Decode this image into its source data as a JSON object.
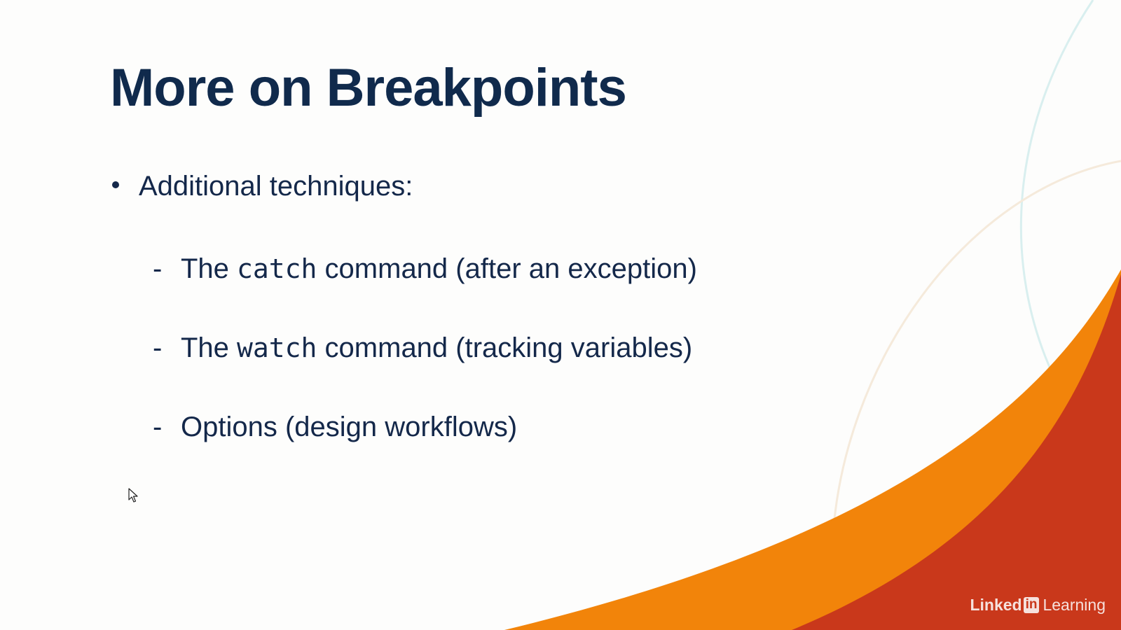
{
  "slide": {
    "title": "More on Breakpoints",
    "bullet": "Additional techniques:",
    "sub_items": [
      {
        "dash": "-",
        "prefix": "The ",
        "code": "catch",
        "suffix": " command (after an exception)"
      },
      {
        "dash": "-",
        "prefix": "The ",
        "code": "watch",
        "suffix": " command (tracking variables)"
      },
      {
        "dash": "-",
        "prefix": "",
        "code": "",
        "suffix": "Options (design workflows)"
      }
    ]
  },
  "branding": {
    "word1": "Linked",
    "box": "in",
    "word2": "Learning"
  },
  "colors": {
    "background": "#fdfdfc",
    "title": "#102a4c",
    "text": "#14284a",
    "orange": "#f2840a",
    "red": "#c9381b"
  },
  "icons": {
    "cursor": "mouse-pointer-icon"
  }
}
